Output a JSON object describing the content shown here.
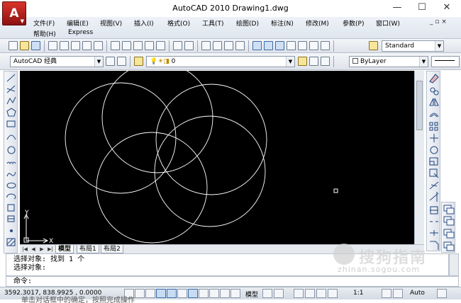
{
  "window": {
    "title": "AutoCAD 2010    Drawing1.dwg",
    "app_button_letter": "A",
    "minimize": "—",
    "maximize": "☐",
    "close": "✕"
  },
  "menu": {
    "items": [
      "文件(F)",
      "编辑(E)",
      "视图(V)",
      "插入(I)",
      "格式(O)",
      "工具(T)",
      "绘图(D)",
      "标注(N)",
      "修改(M)",
      "参数(P)",
      "窗口(W)"
    ],
    "row2": [
      "帮助(H)",
      "Express"
    ],
    "mdi_controls": "_ ▫ ×"
  },
  "toolbar": {
    "text_style": "Standard"
  },
  "toolbar2": {
    "workspace": "AutoCAD 经典",
    "layer": "0",
    "color": "ByLayer"
  },
  "ucs": {
    "x_label": "X",
    "y_label": "Y"
  },
  "tabs": {
    "items": [
      "模型",
      "布局1",
      "布局2"
    ]
  },
  "command": {
    "history": [
      "选择对象: 找到 1 个",
      "选择对象:"
    ],
    "prompt": "命令:"
  },
  "status": {
    "coordinates": "3592.3017, 838.9925 , 0.0000",
    "model": "模型",
    "scale": "1:1",
    "auto": "Auto"
  },
  "watermark": {
    "text": "搜狗指南",
    "sub": "zhinan.sogou.com"
  },
  "bottom_text": "单击对话框中的确定，按照完成操作",
  "colors": {
    "canvas": "#000000",
    "drawing_stroke": "#ffffff",
    "app_button": "#c0261f",
    "ui_chrome": "#dfe6ef"
  }
}
